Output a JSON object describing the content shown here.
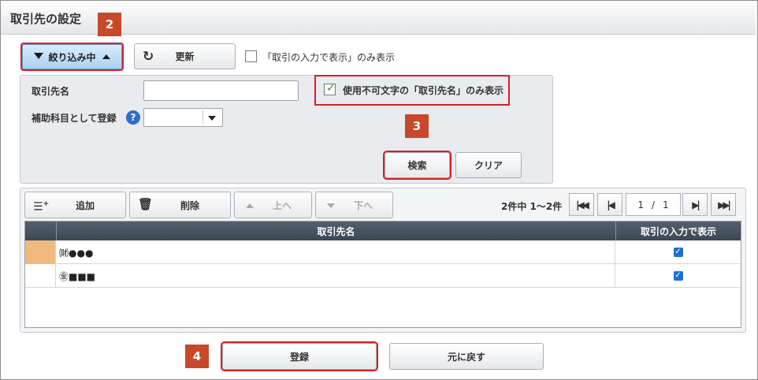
{
  "title": "取引先の設定",
  "markers": {
    "m2": "2",
    "m3": "3",
    "m4": "4"
  },
  "toolbar": {
    "filter_label": "絞り込み中",
    "refresh_label": "更新",
    "show_only_label": "「取引の入力で表示」のみ表示"
  },
  "filter": {
    "name_label": "取引先名",
    "name_value": "",
    "subaccount_label": "補助科目として登録",
    "subaccount_value": "",
    "unusable_label": "使用不可文字の「取引先名」のみ表示",
    "unusable_checked": true,
    "search_label": "検索",
    "clear_label": "クリア"
  },
  "grid_toolbar": {
    "add_label": "追加",
    "delete_label": "削除",
    "up_label": "上へ",
    "down_label": "下へ"
  },
  "pager": {
    "summary": "2件中 1～2件",
    "page": "1",
    "sep": "/",
    "total": "1"
  },
  "table": {
    "columns": [
      "取引先名",
      "取引の入力で表示"
    ],
    "rows": [
      {
        "name": "㈶●●●",
        "show": true
      },
      {
        "name": "㊎■■■",
        "show": true
      }
    ]
  },
  "footer": {
    "register_label": "登録",
    "back_label": "元に戻す"
  },
  "colors": {
    "accent": "#c8482a",
    "highlight": "#d71f26",
    "header": "#4a5463",
    "check": "#1e6fd1"
  }
}
